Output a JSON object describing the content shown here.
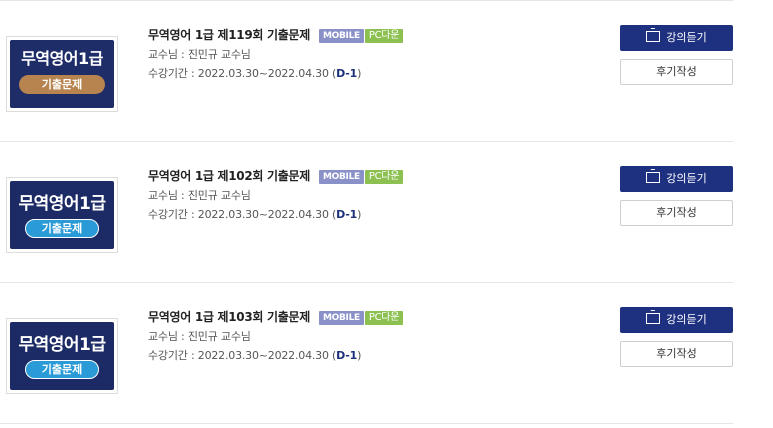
{
  "courses": [
    {
      "thumb_title": "무역영어1급",
      "thumb_tag": "기출문제",
      "title": "무역영어 1급 제119회 기출문제",
      "badge_mobile": "MOBILE",
      "badge_pc": "PC다운",
      "teacher": "교수님 : 진민규 교수님",
      "period_prefix": "수강기간 : 2022.03.30~2022.04.30 (",
      "dday": "D-1",
      "period_suffix": ")",
      "watch_label": "강의듣기",
      "review_label": "후기작성"
    },
    {
      "thumb_title": "무역영어1급",
      "thumb_tag": "기출문제",
      "title": "무역영어 1급 제102회 기출문제",
      "badge_mobile": "MOBILE",
      "badge_pc": "PC다운",
      "teacher": "교수님 : 진민규 교수님",
      "period_prefix": "수강기간 : 2022.03.30~2022.04.30 (",
      "dday": "D-1",
      "period_suffix": ")",
      "watch_label": "강의듣기",
      "review_label": "후기작성"
    },
    {
      "thumb_title": "무역영어1급",
      "thumb_tag": "기출문제",
      "title": "무역영어 1급 제103회 기출문제",
      "badge_mobile": "MOBILE",
      "badge_pc": "PC다운",
      "teacher": "교수님 : 진민규 교수님",
      "period_prefix": "수강기간 : 2022.03.30~2022.04.30 (",
      "dday": "D-1",
      "period_suffix": ")",
      "watch_label": "강의듣기",
      "review_label": "후기작성"
    }
  ],
  "colors": {
    "primary_button": "#1e3180",
    "mobile_badge": "#8a91c9",
    "pc_badge": "#8cc152",
    "thumb_bg": "#1e2c68",
    "thumb_tag_gold": "#b7844f",
    "thumb_tag_blue": "#2a9bd6"
  },
  "icons": {
    "watch_button_icon": "tv-icon"
  }
}
